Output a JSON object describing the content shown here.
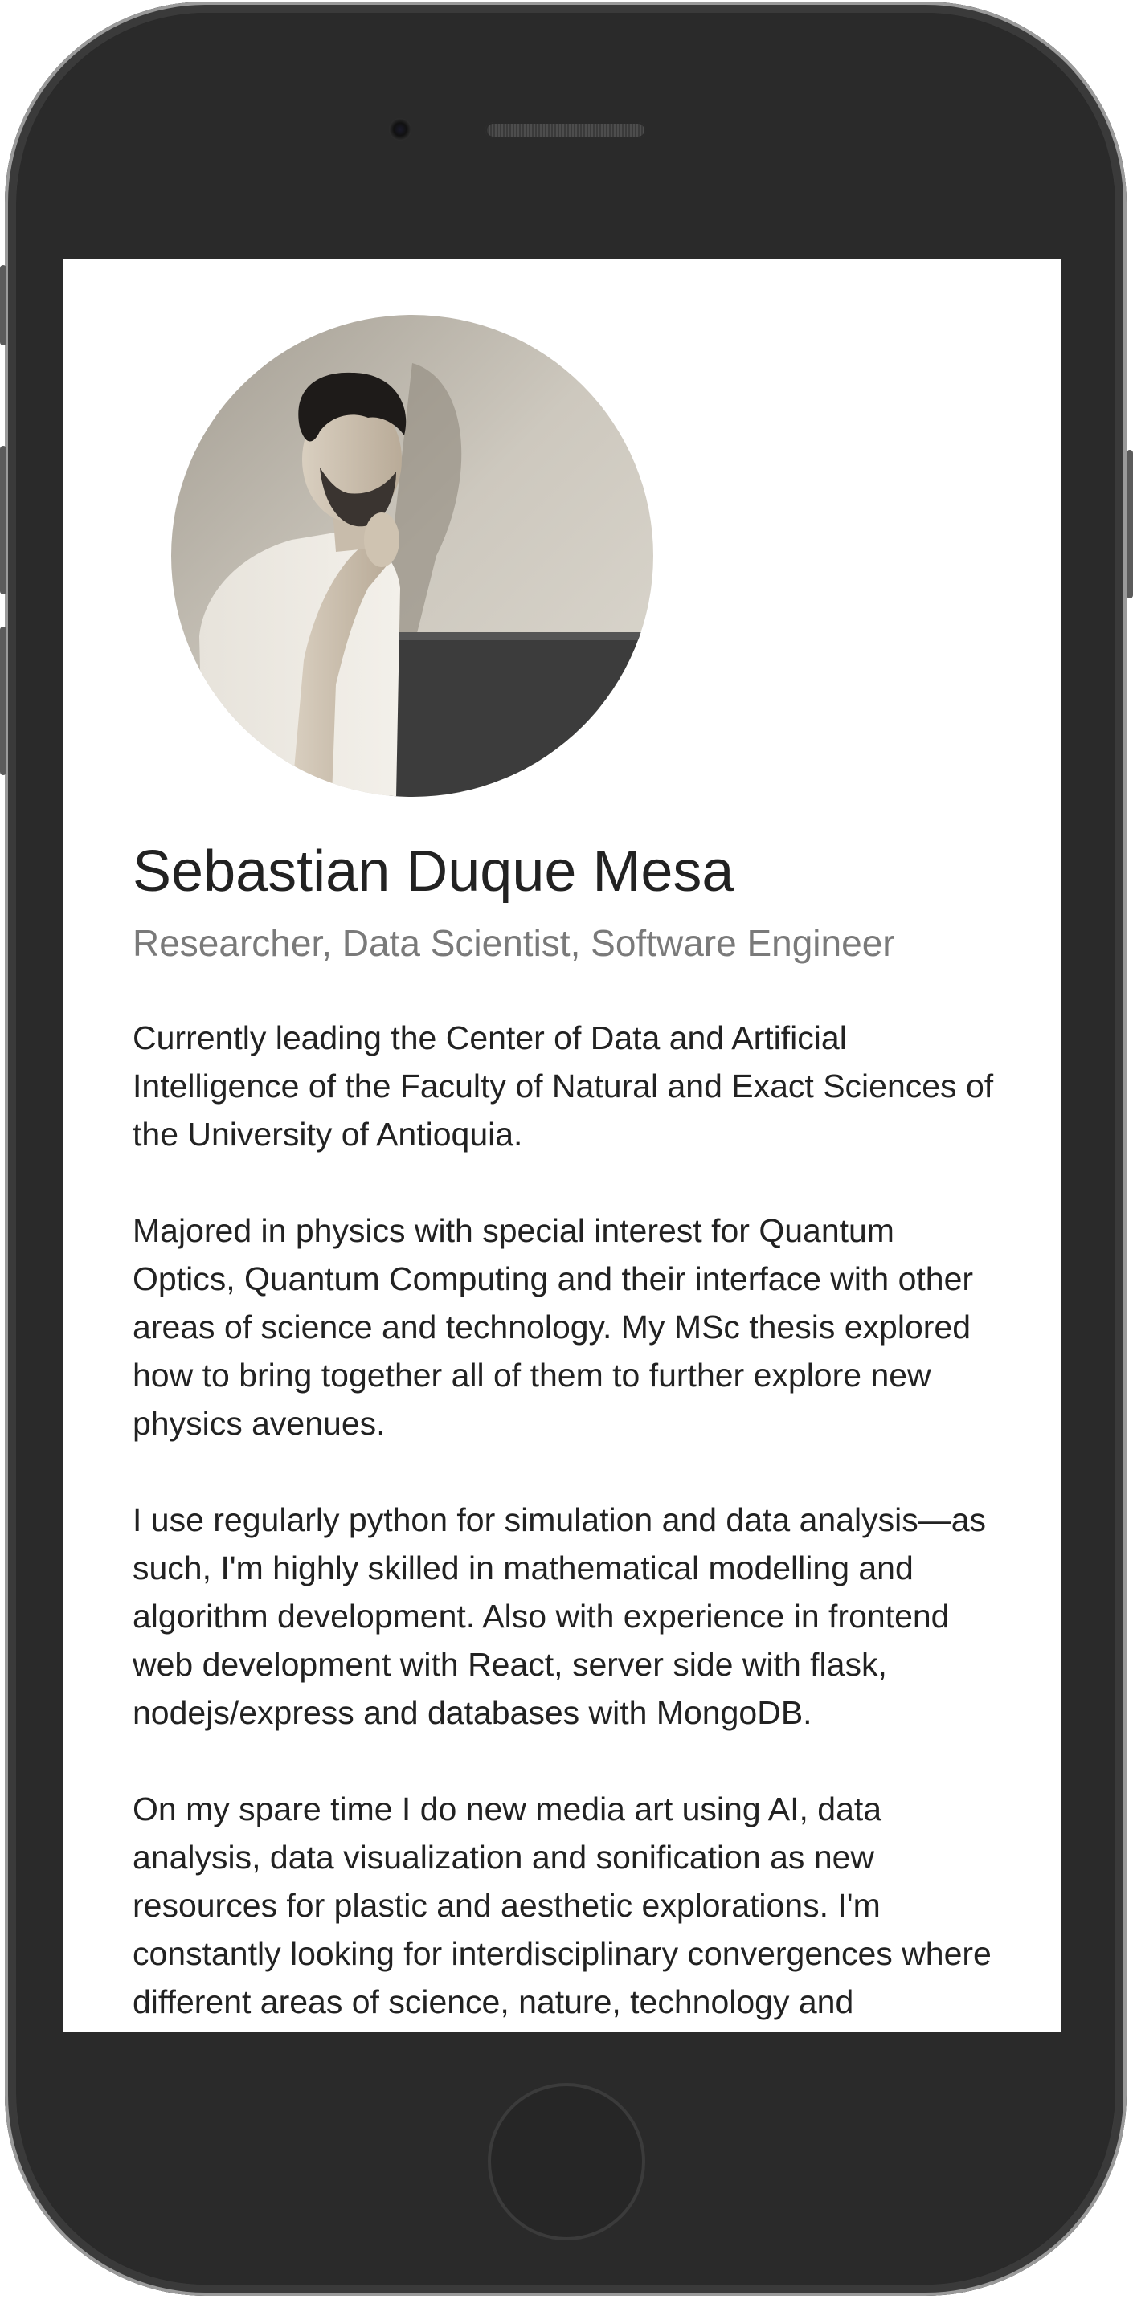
{
  "profile": {
    "name": "Sebastian Duque Mesa",
    "subtitle": "Researcher, Data Scientist, Software Engineer",
    "photo_icon": "profile-photo"
  },
  "bio": {
    "paragraphs": [
      "Currently leading the Center of Data and Artificial Intelligence of the Faculty of Natural and Exact Sciences of the University of Antioquia.",
      "Majored in physics with special interest for Quantum Optics, Quantum Computing and their interface with other areas of science and technology. My MSc thesis explored how to bring together all of them to further explore new physics avenues.",
      "I use regularly python for simulation and data analysis—as such, I'm highly skilled in mathematical modelling and algorithm development. Also with experience in frontend web development with React, server side with flask, nodejs/express and databases with MongoDB.",
      "On my spare time I do new media art using AI, data analysis, data visualization and sonification as new resources for plastic and aesthetic explorations. I'm constantly looking for interdisciplinary convergences where different areas of science, nature, technology and"
    ]
  },
  "device": {
    "frame_color": "#262626",
    "screen_color": "#ffffff",
    "text_color": "#222222",
    "subtitle_color": "#7a7a7a"
  }
}
